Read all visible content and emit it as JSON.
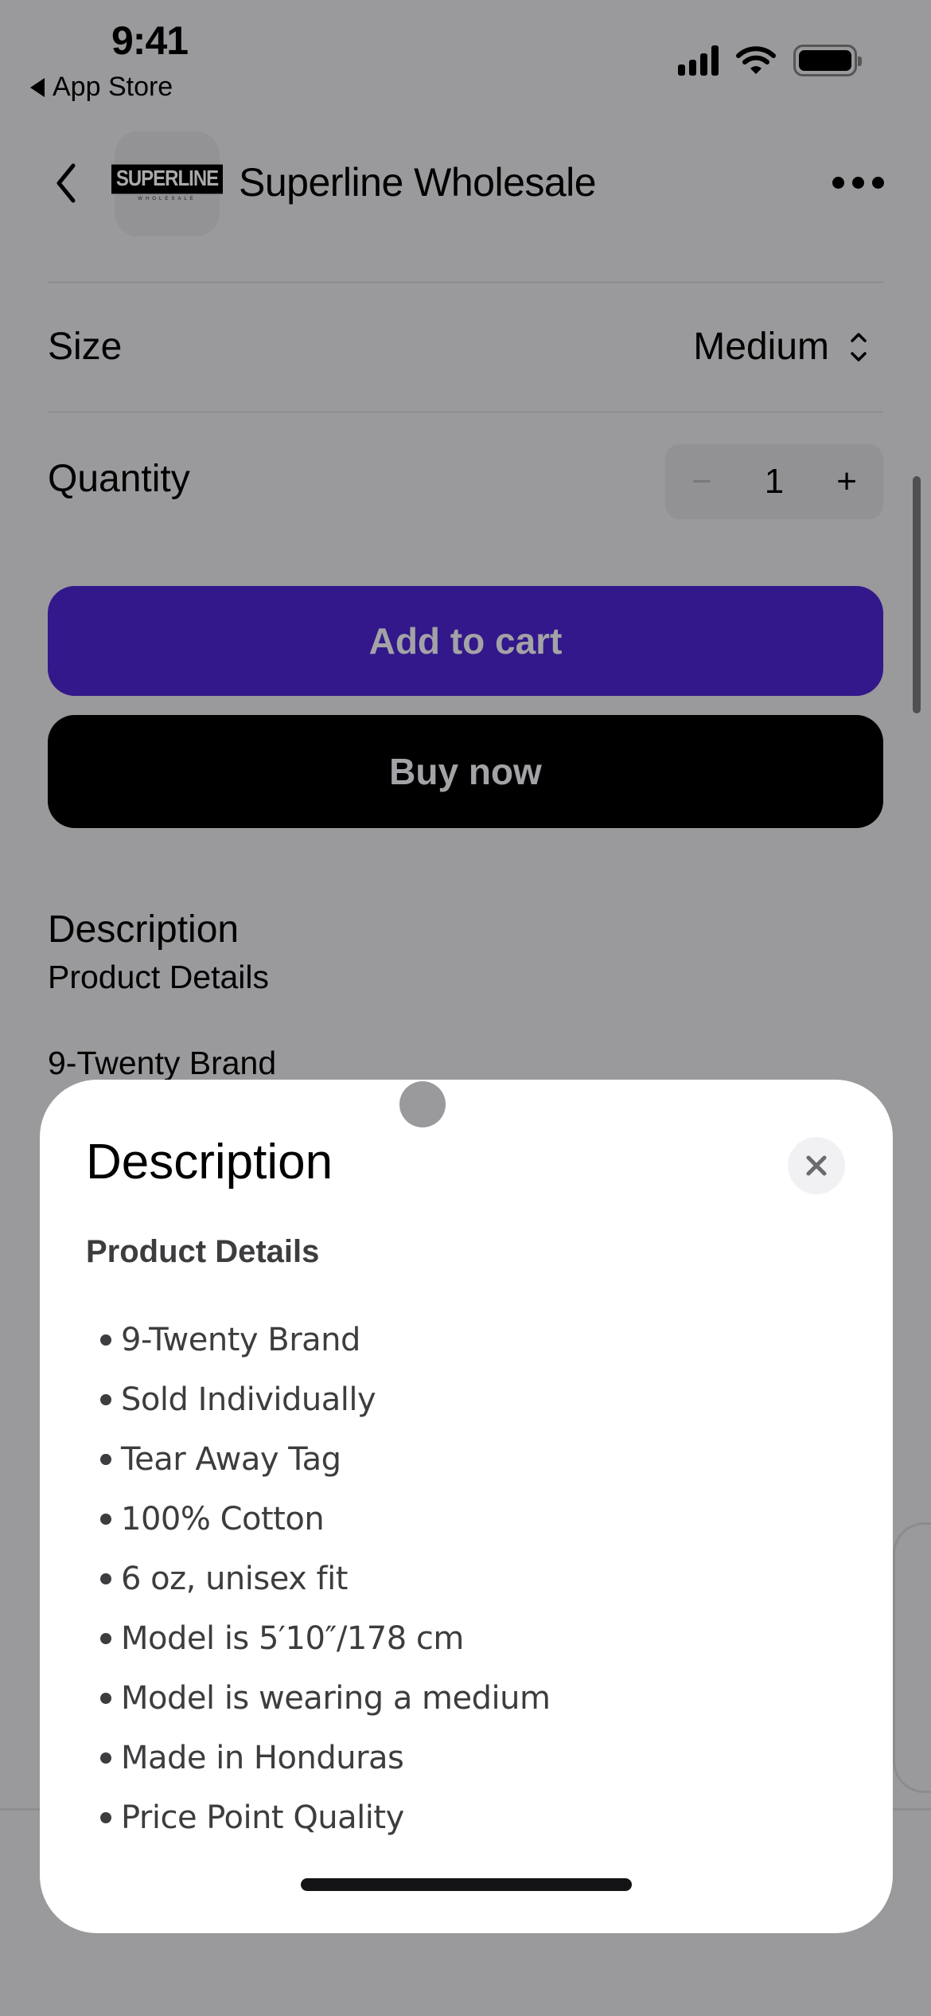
{
  "status_bar": {
    "time": "9:41",
    "back_app": "App Store",
    "icons": [
      "cellular-signal-icon",
      "wifi-icon",
      "battery-icon"
    ]
  },
  "nav": {
    "back_icon": "chevron-left-icon",
    "logo_text": "SUPERLINE",
    "logo_subtext": "WHOLESALE",
    "title": "Superline Wholesale",
    "more_icon": "ellipsis-icon"
  },
  "options": {
    "size_label": "Size",
    "size_value": "Medium",
    "quantity_label": "Quantity",
    "quantity_value": "1",
    "minus_symbol": "−",
    "plus_symbol": "+"
  },
  "buttons": {
    "add_to_cart": "Add to cart",
    "buy_now": "Buy now"
  },
  "background_description": {
    "title": "Description",
    "subtitle": "Product Details",
    "first_item": "9-Twenty Brand"
  },
  "sheet": {
    "title": "Description",
    "subtitle": "Product Details",
    "close_icon": "close-icon",
    "items": [
      "9-Twenty Brand",
      "Sold Individually",
      "Tear Away Tag",
      "100% Cotton",
      "6 oz, unisex fit",
      "Model is 5′10″/178 cm",
      "Model is wearing a medium",
      "Made in Honduras",
      "Price Point Quality"
    ]
  },
  "colors": {
    "add_to_cart_bg": "#32188a",
    "buy_now_bg": "#000000",
    "scrim": "#9a999c",
    "sheet_bg": "#ffffff"
  }
}
